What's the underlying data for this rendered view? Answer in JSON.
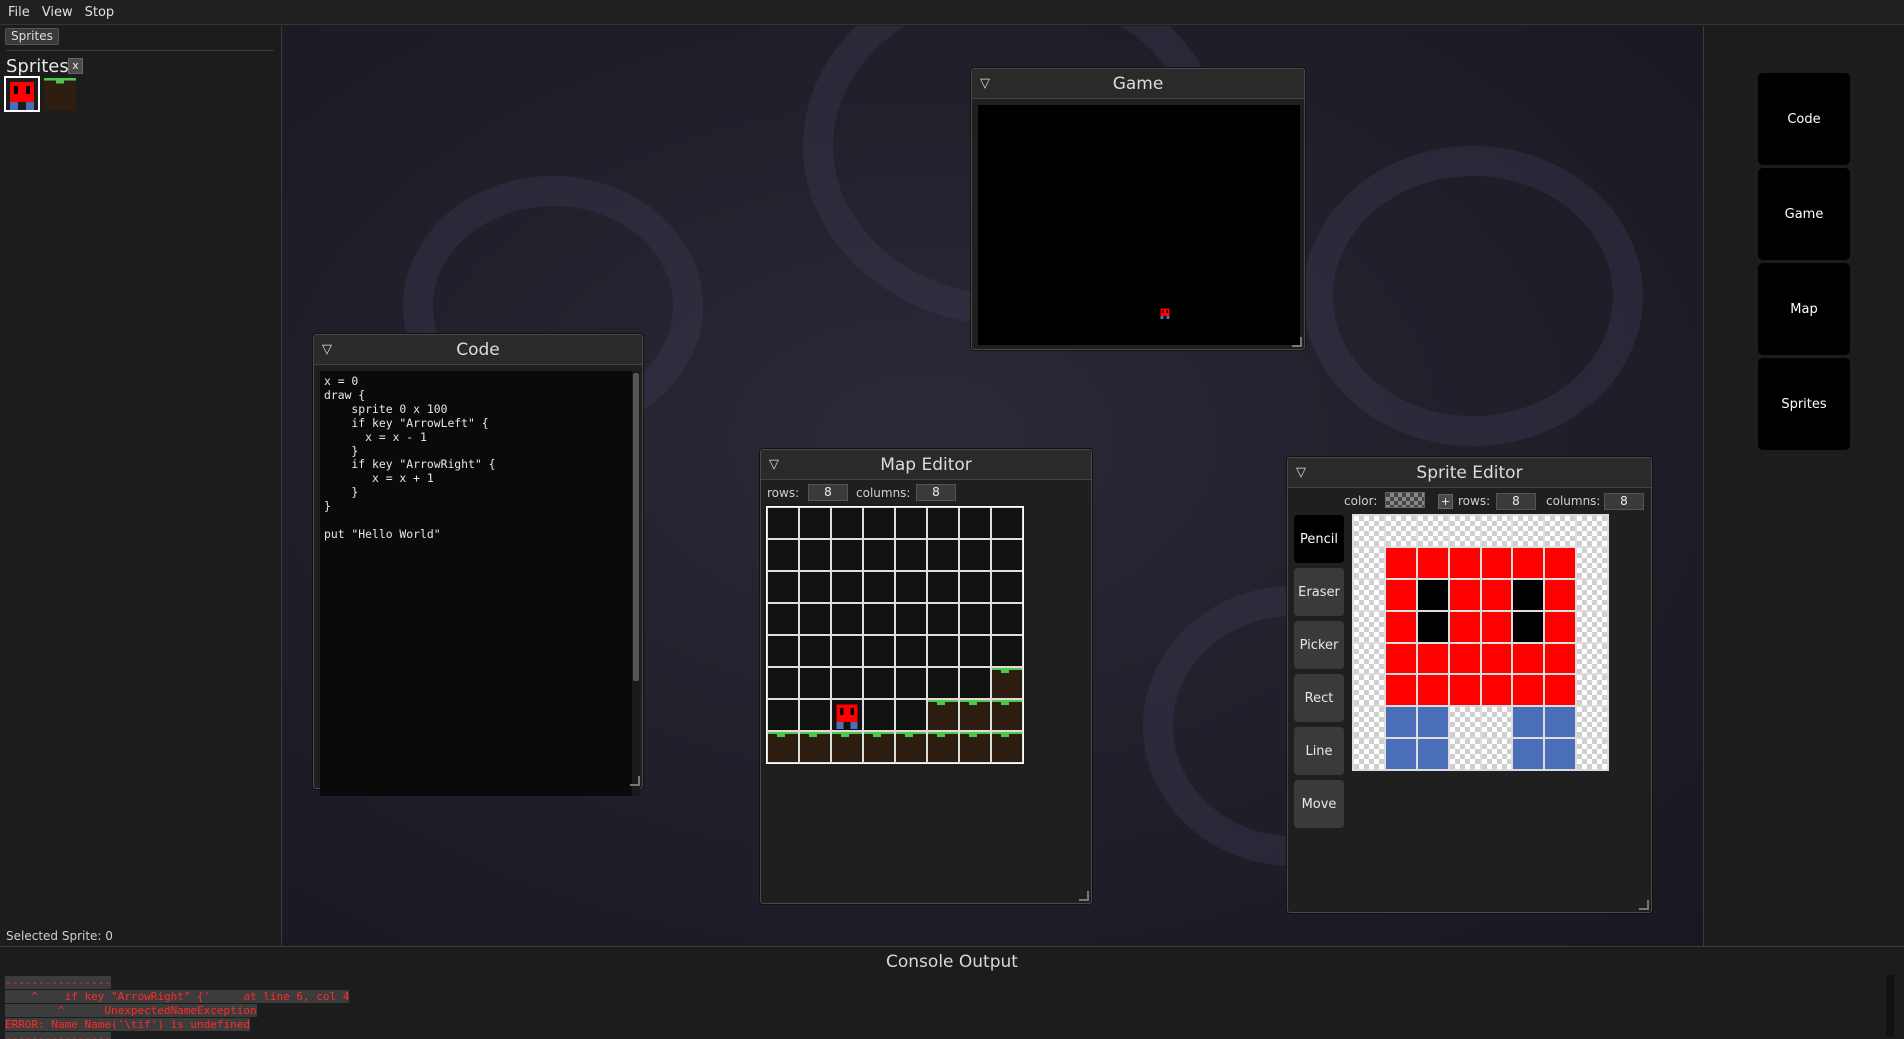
{
  "menu": {
    "items": [
      "File",
      "View",
      "Stop"
    ]
  },
  "sidebar": {
    "tab_label": "Sprites",
    "heading": "Sprites",
    "close_label": "x",
    "selected_sprite_text": "Selected Sprite: 0"
  },
  "code_window": {
    "title": "Code",
    "source": "x = 0\ndraw {\n    sprite 0 x 100\n    if key \"ArrowLeft\" {\n      x = x - 1\n    }\n    if key \"ArrowRight\" {\n       x = x + 1\n    }\n}\n\nput \"Hello World\""
  },
  "game_window": {
    "title": "Game"
  },
  "map_editor": {
    "title": "Map Editor",
    "rows_label": "rows:",
    "rows_value": "8",
    "columns_label": "columns:",
    "columns_value": "8"
  },
  "sprite_editor": {
    "title": "Sprite Editor",
    "color_label": "color:",
    "plus_label": "+",
    "rows_label": "rows:",
    "rows_value": "8",
    "columns_label": "columns:",
    "columns_value": "8",
    "tools": [
      "Pencil",
      "Eraser",
      "Picker",
      "Rect",
      "Line",
      "Move"
    ],
    "active_tool": "Pencil",
    "pixels": [
      "tttttttt",
      "trrrrrrt",
      "trkrrkrt",
      "trkrrkrt",
      "trrrrrrt",
      "trrrrrrt",
      "tbbttbbt",
      "tbbttbbt"
    ]
  },
  "right_panel": {
    "buttons": [
      "Code",
      "Game",
      "Map",
      "Sprites"
    ]
  },
  "console": {
    "title": "Console Output",
    "lines": [
      "----------------",
      "    ^    if key \"ArrowRight\" {'     at line 6, col 4",
      "        ^      UnexpectedNameException",
      "ERROR: Name Name('\\tif') is undefined",
      "----------------"
    ]
  },
  "colors": {
    "sprite_red": "#ff0000",
    "sprite_blue": "#4a6fb8",
    "grass_green": "#4ec94e",
    "dirt_brown": "#2e1e12",
    "error_red": "#ff2a2a"
  }
}
